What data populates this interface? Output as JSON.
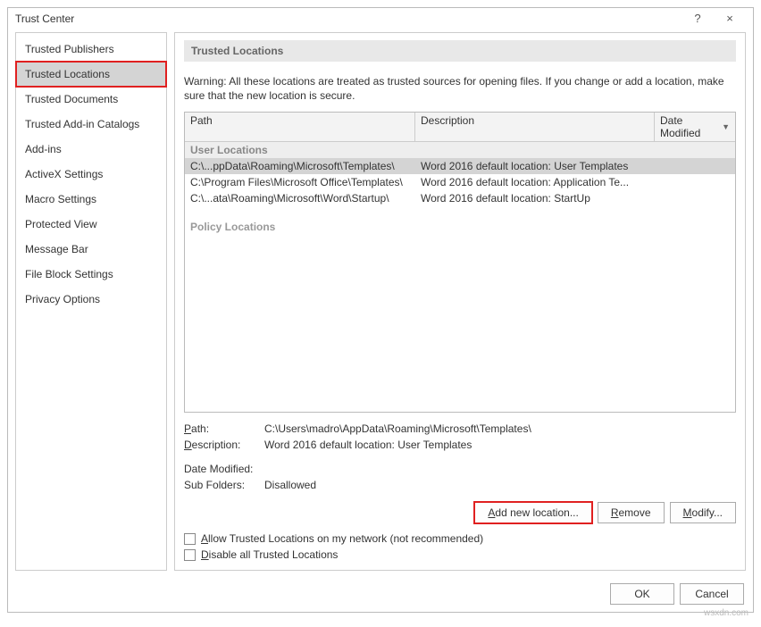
{
  "titlebar": {
    "title": "Trust Center",
    "help": "?",
    "close": "×"
  },
  "sidebar": {
    "items": [
      {
        "label": "Trusted Publishers"
      },
      {
        "label": "Trusted Locations",
        "selected": true
      },
      {
        "label": "Trusted Documents"
      },
      {
        "label": "Trusted Add-in Catalogs"
      },
      {
        "label": "Add-ins"
      },
      {
        "label": "ActiveX Settings"
      },
      {
        "label": "Macro Settings"
      },
      {
        "label": "Protected View"
      },
      {
        "label": "Message Bar"
      },
      {
        "label": "File Block Settings"
      },
      {
        "label": "Privacy Options"
      }
    ]
  },
  "main": {
    "section_title": "Trusted Locations",
    "warning": "Warning: All these locations are treated as trusted sources for opening files.  If you change or add a location, make sure that the new location is secure.",
    "columns": {
      "path": "Path",
      "desc": "Description",
      "date": "Date Modified"
    },
    "group_user": "User Locations",
    "rows": [
      {
        "path": "C:\\...ppData\\Roaming\\Microsoft\\Templates\\",
        "desc": "Word 2016 default location: User Templates",
        "selected": true
      },
      {
        "path": "C:\\Program Files\\Microsoft Office\\Templates\\",
        "desc": "Word 2016 default location: Application Te..."
      },
      {
        "path": "C:\\...ata\\Roaming\\Microsoft\\Word\\Startup\\",
        "desc": "Word 2016 default location: StartUp"
      }
    ],
    "group_policy": "Policy Locations",
    "details": {
      "path_label": "Path:",
      "path_value": "C:\\Users\\madro\\AppData\\Roaming\\Microsoft\\Templates\\",
      "desc_label": "Description:",
      "desc_value": "Word 2016 default location: User Templates",
      "date_label": "Date Modified:",
      "date_value": "",
      "sub_label": "Sub Folders:",
      "sub_value": "Disallowed"
    },
    "buttons": {
      "add": "Add new location...",
      "remove": "Remove",
      "modify": "Modify..."
    },
    "checks": {
      "allow": "Allow Trusted Locations on my network (not recommended)",
      "disable": "Disable all Trusted Locations"
    }
  },
  "footer": {
    "ok": "OK",
    "cancel": "Cancel"
  },
  "watermark": "wsxdn.com"
}
